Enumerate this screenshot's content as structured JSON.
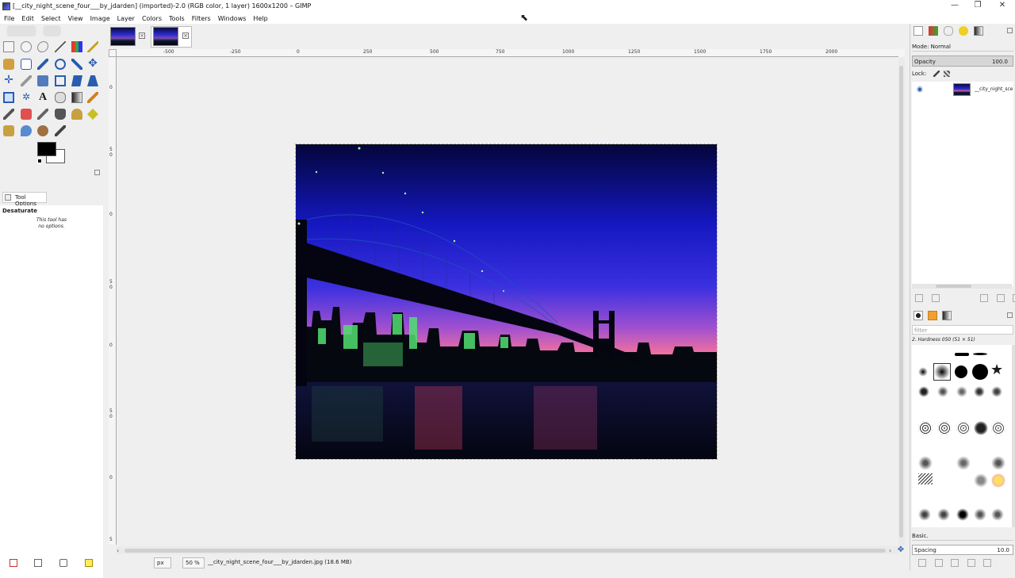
{
  "window": {
    "title": "[__city_night_scene_four___by_jdarden] (imported)-2.0 (RGB color, 1 layer) 1600x1200 – GIMP",
    "minimize": "—",
    "maximize": "❐",
    "close": "✕"
  },
  "menu": [
    "File",
    "Edit",
    "Select",
    "View",
    "Image",
    "Layer",
    "Colors",
    "Tools",
    "Filters",
    "Windows",
    "Help"
  ],
  "tool_options": {
    "tab_label": "Tool Options",
    "tool_name": "Desaturate",
    "message_line1": "This tool has",
    "message_line2": "no options."
  },
  "rulers": {
    "horizontal": [
      "-500",
      "-250",
      "0",
      "250",
      "500",
      "750",
      "1000",
      "1250",
      "1500",
      "1750",
      "2000"
    ],
    "vertical": [
      "0",
      "5",
      "0",
      "0",
      "5",
      "0",
      "0",
      "5",
      "0",
      "0",
      "5",
      "0"
    ]
  },
  "status": {
    "unit": "px",
    "zoom": "50 %",
    "file_info": "__city_night_scene_four___by_jdarden.jpg (18.6 MB)"
  },
  "layers_panel": {
    "mode_label": "Mode: Normal",
    "opacity_label": "Opacity",
    "opacity_value": "100.0",
    "lock_label": "Lock:",
    "layer_name": "__city_night_sce"
  },
  "brushes_panel": {
    "filter_placeholder": "filter",
    "brush_title": "2. Hardness 050 (51 × 51)",
    "preset": "Basic.",
    "spacing_label": "Spacing",
    "spacing_value": "10.0"
  },
  "icons": {
    "eye": "eye-icon",
    "chain": "chain-icon"
  }
}
